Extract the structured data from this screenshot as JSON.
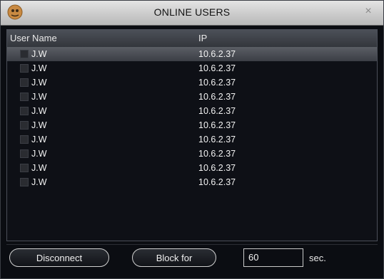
{
  "window": {
    "title": "ONLINE USERS"
  },
  "list": {
    "columns": {
      "user_name": "User Name",
      "ip": "IP"
    },
    "rows": [
      {
        "user": "J.W",
        "ip": "10.6.2.37",
        "selected": true
      },
      {
        "user": "J.W",
        "ip": "10.6.2.37"
      },
      {
        "user": "J.W",
        "ip": "10.6.2.37"
      },
      {
        "user": "J.W",
        "ip": "10.6.2.37"
      },
      {
        "user": "J.W",
        "ip": "10.6.2.37"
      },
      {
        "user": "J.W",
        "ip": "10.6.2.37"
      },
      {
        "user": "J.W",
        "ip": "10.6.2.37"
      },
      {
        "user": "J.W",
        "ip": "10.6.2.37"
      },
      {
        "user": "J.W",
        "ip": "10.6.2.37"
      },
      {
        "user": "J.W",
        "ip": "10.6.2.37"
      }
    ]
  },
  "actions": {
    "disconnect_label": "Disconnect",
    "block_label": "Block for",
    "block_time_value": "60",
    "block_time_unit": "sec."
  },
  "colors": {
    "panel_background": "#0e1016",
    "selected_row": "#4b4e55",
    "titlebar": "#d8d8d8"
  },
  "icons": {
    "app_logo": "app-logo-icon",
    "close": "close-icon"
  }
}
